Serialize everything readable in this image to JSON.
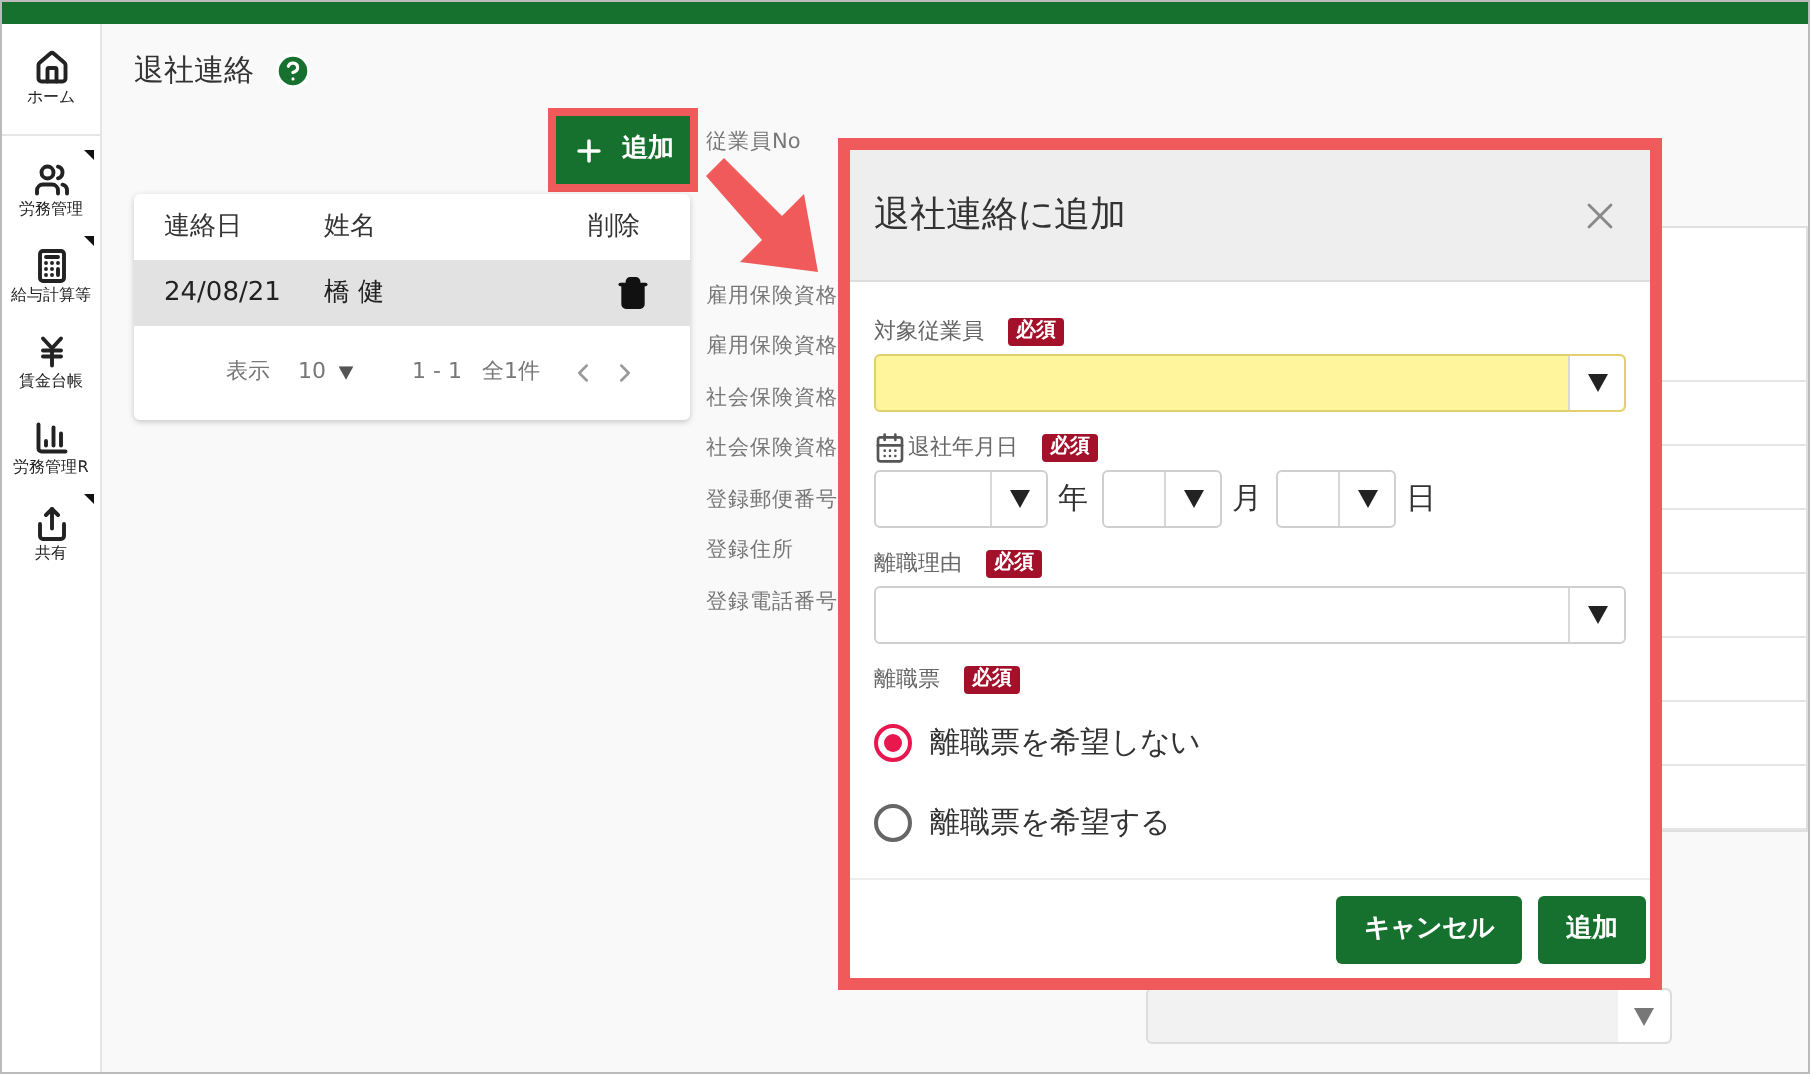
{
  "sidebar": {
    "items": [
      {
        "label": "ホーム",
        "has_submenu": false
      },
      {
        "label": "労務管理",
        "has_submenu": true
      },
      {
        "label": "給与計算等",
        "has_submenu": true
      },
      {
        "label": "賃金台帳",
        "has_submenu": false
      },
      {
        "label": "労務管理R",
        "has_submenu": false
      },
      {
        "label": "共有",
        "has_submenu": true
      }
    ]
  },
  "page": {
    "title": "退社連絡"
  },
  "add_button": {
    "label": "追加",
    "highlighted": true
  },
  "table": {
    "columns": [
      "連絡日",
      "姓名",
      "削除"
    ],
    "rows": [
      {
        "date": "24/08/21",
        "name": "橋 健",
        "selected": true
      }
    ],
    "pagination": {
      "show_label": "表示",
      "page_size": "10",
      "range": "1 - 1",
      "total": "全1件"
    }
  },
  "detail_labels": [
    "従業員No",
    "雇用保険資格",
    "雇用保険資格",
    "社会保険資格",
    "社会保険資格",
    "登録郵便番号",
    "登録住所",
    "登録電話番号"
  ],
  "dialog": {
    "title": "退社連絡に追加",
    "highlighted": true,
    "fields": [
      {
        "kind": "select",
        "label": "対象従業員",
        "badge": "必須",
        "focused": true
      },
      {
        "kind": "date",
        "label": "退社年月日",
        "badge": "必須",
        "units": [
          "年",
          "月",
          "日"
        ]
      },
      {
        "kind": "select",
        "label": "離職理由",
        "badge": "必須",
        "focused": false
      },
      {
        "kind": "radio",
        "label": "離職票",
        "badge": "必須",
        "options": [
          {
            "label": "離職票を希望しない",
            "selected": true
          },
          {
            "label": "離職票を希望する",
            "selected": false
          }
        ]
      }
    ],
    "buttons": [
      "キャンセル",
      "追加"
    ]
  },
  "footer_select": {
    "disabled": true
  }
}
